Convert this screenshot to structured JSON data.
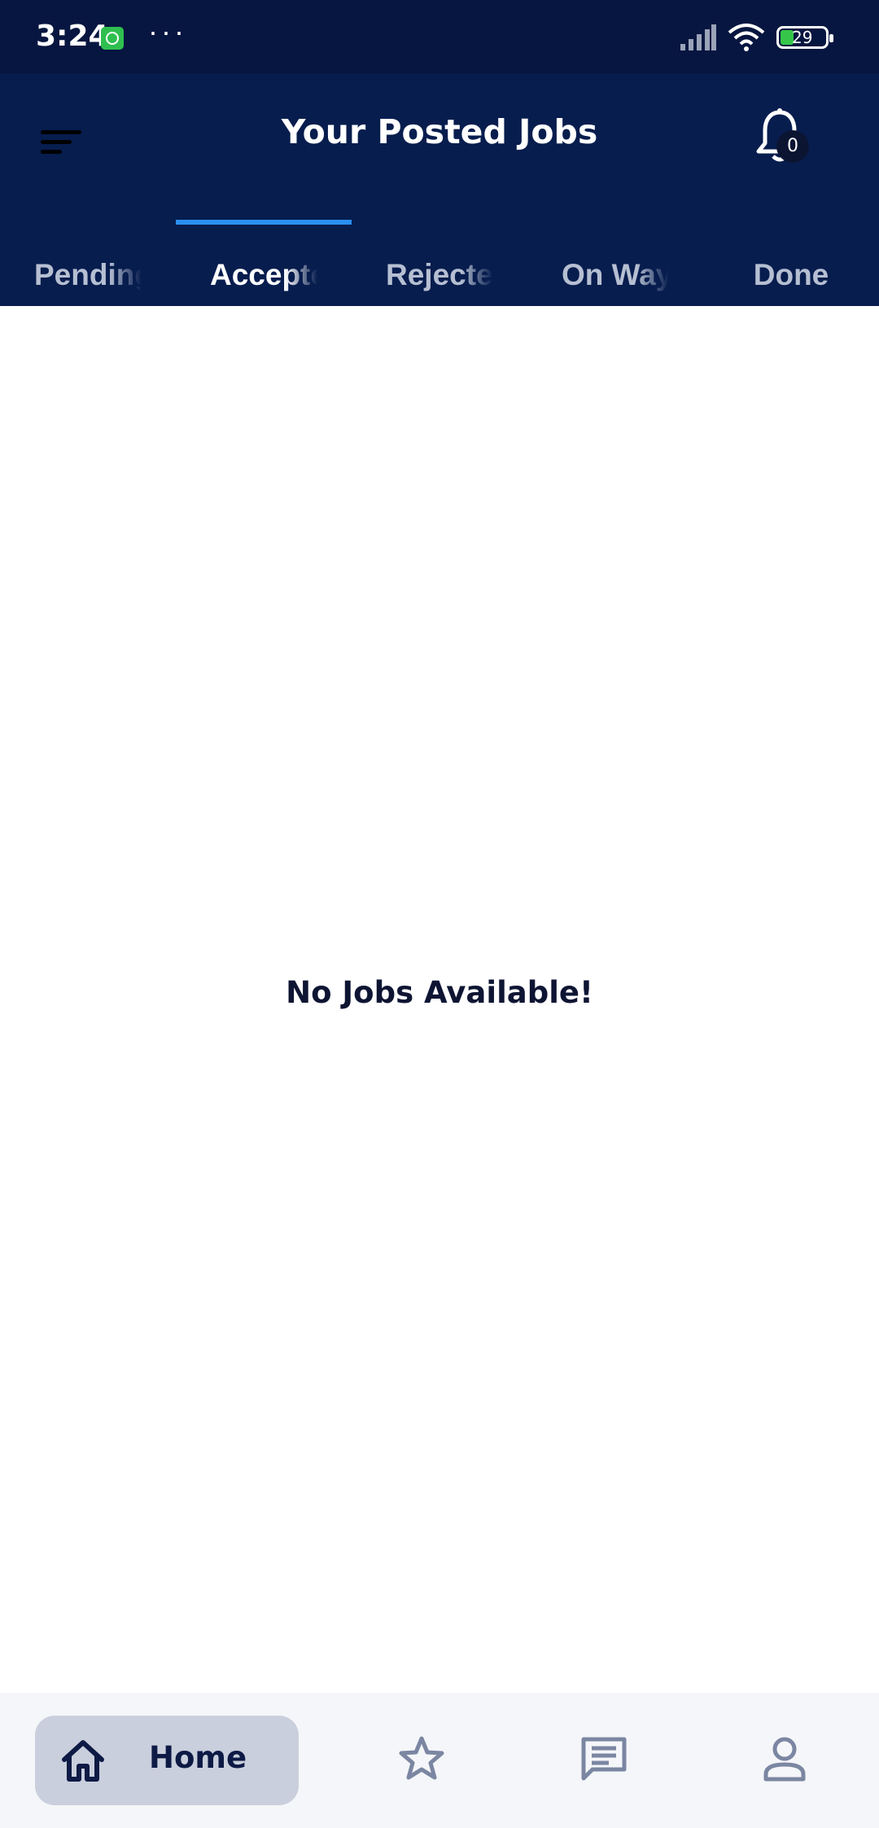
{
  "status_bar": {
    "time": "3:24",
    "dots": "···",
    "battery": "29",
    "icons": [
      "whatsapp-icon",
      "signal-icon",
      "wifi-icon",
      "battery-icon"
    ]
  },
  "header": {
    "title": "Your Posted Jobs",
    "notification_count": "0"
  },
  "tabs": [
    {
      "label": "Pending"
    },
    {
      "label": "Accepted",
      "active": true
    },
    {
      "label": "Rejected"
    },
    {
      "label": "On Way"
    },
    {
      "label": "Done"
    }
  ],
  "content": {
    "empty_message": "No Jobs Available!"
  },
  "bottom_nav": {
    "home_label": "Home",
    "items": [
      "home-icon",
      "star-icon",
      "chat-icon",
      "profile-icon"
    ]
  },
  "colors": {
    "header_bg": "#071d4e",
    "status_bg": "#061640",
    "tab_indicator": "#2a8ff0",
    "nav_active_bg": "#c9cfdc"
  }
}
